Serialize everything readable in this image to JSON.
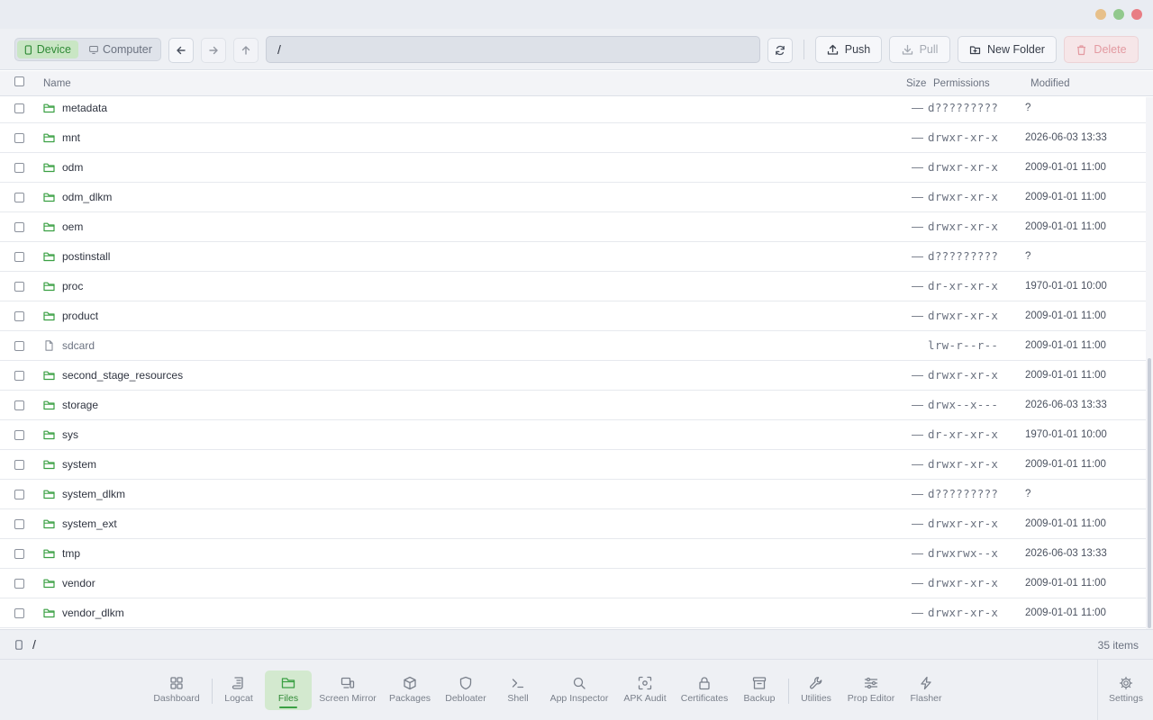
{
  "toolbar": {
    "device_label": "Device",
    "computer_label": "Computer",
    "path_value": "/",
    "push_label": "Push",
    "pull_label": "Pull",
    "new_folder_label": "New Folder",
    "delete_label": "Delete"
  },
  "table": {
    "columns": {
      "name": "Name",
      "size": "Size",
      "permissions": "Permissions",
      "modified": "Modified"
    },
    "rows": [
      {
        "name": "metadata",
        "type": "folder",
        "size": "—",
        "permissions": "d?????????",
        "modified": "?"
      },
      {
        "name": "mnt",
        "type": "folder",
        "size": "—",
        "permissions": "drwxr-xr-x",
        "modified": "2026-06-03 13:33"
      },
      {
        "name": "odm",
        "type": "folder",
        "size": "—",
        "permissions": "drwxr-xr-x",
        "modified": "2009-01-01 11:00"
      },
      {
        "name": "odm_dlkm",
        "type": "folder",
        "size": "—",
        "permissions": "drwxr-xr-x",
        "modified": "2009-01-01 11:00"
      },
      {
        "name": "oem",
        "type": "folder",
        "size": "—",
        "permissions": "drwxr-xr-x",
        "modified": "2009-01-01 11:00"
      },
      {
        "name": "postinstall",
        "type": "folder",
        "size": "—",
        "permissions": "d?????????",
        "modified": "?"
      },
      {
        "name": "proc",
        "type": "folder",
        "size": "—",
        "permissions": "dr-xr-xr-x",
        "modified": "1970-01-01 10:00"
      },
      {
        "name": "product",
        "type": "folder",
        "size": "—",
        "permissions": "drwxr-xr-x",
        "modified": "2009-01-01 11:00"
      },
      {
        "name": "sdcard",
        "type": "file",
        "size": "",
        "permissions": "lrw-r--r--",
        "modified": "2009-01-01 11:00"
      },
      {
        "name": "second_stage_resources",
        "type": "folder",
        "size": "—",
        "permissions": "drwxr-xr-x",
        "modified": "2009-01-01 11:00"
      },
      {
        "name": "storage",
        "type": "folder",
        "size": "—",
        "permissions": "drwx--x---",
        "modified": "2026-06-03 13:33"
      },
      {
        "name": "sys",
        "type": "folder",
        "size": "—",
        "permissions": "dr-xr-xr-x",
        "modified": "1970-01-01 10:00"
      },
      {
        "name": "system",
        "type": "folder",
        "size": "—",
        "permissions": "drwxr-xr-x",
        "modified": "2009-01-01 11:00"
      },
      {
        "name": "system_dlkm",
        "type": "folder",
        "size": "—",
        "permissions": "d?????????",
        "modified": "?"
      },
      {
        "name": "system_ext",
        "type": "folder",
        "size": "—",
        "permissions": "drwxr-xr-x",
        "modified": "2009-01-01 11:00"
      },
      {
        "name": "tmp",
        "type": "folder",
        "size": "—",
        "permissions": "drwxrwx--x",
        "modified": "2026-06-03 13:33"
      },
      {
        "name": "vendor",
        "type": "folder",
        "size": "—",
        "permissions": "drwxr-xr-x",
        "modified": "2009-01-01 11:00"
      },
      {
        "name": "vendor_dlkm",
        "type": "folder",
        "size": "—",
        "permissions": "drwxr-xr-x",
        "modified": "2009-01-01 11:00"
      }
    ]
  },
  "status": {
    "path": "/",
    "count": "35 items"
  },
  "nav": {
    "items": [
      {
        "label": "Dashboard",
        "icon": "dashboard-icon"
      },
      {
        "label": "Logcat",
        "icon": "logcat-icon"
      },
      {
        "label": "Files",
        "icon": "folder-icon"
      },
      {
        "label": "Screen Mirror",
        "icon": "screen-mirror-icon"
      },
      {
        "label": "Packages",
        "icon": "package-icon"
      },
      {
        "label": "Debloater",
        "icon": "shield-icon"
      },
      {
        "label": "Shell",
        "icon": "terminal-icon"
      },
      {
        "label": "App Inspector",
        "icon": "search-icon"
      },
      {
        "label": "APK Audit",
        "icon": "scan-icon"
      },
      {
        "label": "Certificates",
        "icon": "lock-icon"
      },
      {
        "label": "Backup",
        "icon": "archive-icon"
      },
      {
        "label": "Utilities",
        "icon": "wrench-icon"
      },
      {
        "label": "Prop Editor",
        "icon": "sliders-icon"
      },
      {
        "label": "Flasher",
        "icon": "lightning-icon"
      }
    ],
    "settings_label": "Settings",
    "active": "Files"
  },
  "colors": {
    "accent": "#3aa043",
    "active_bg": "#d3e9cf",
    "delete_tint": "#e39aa1"
  }
}
